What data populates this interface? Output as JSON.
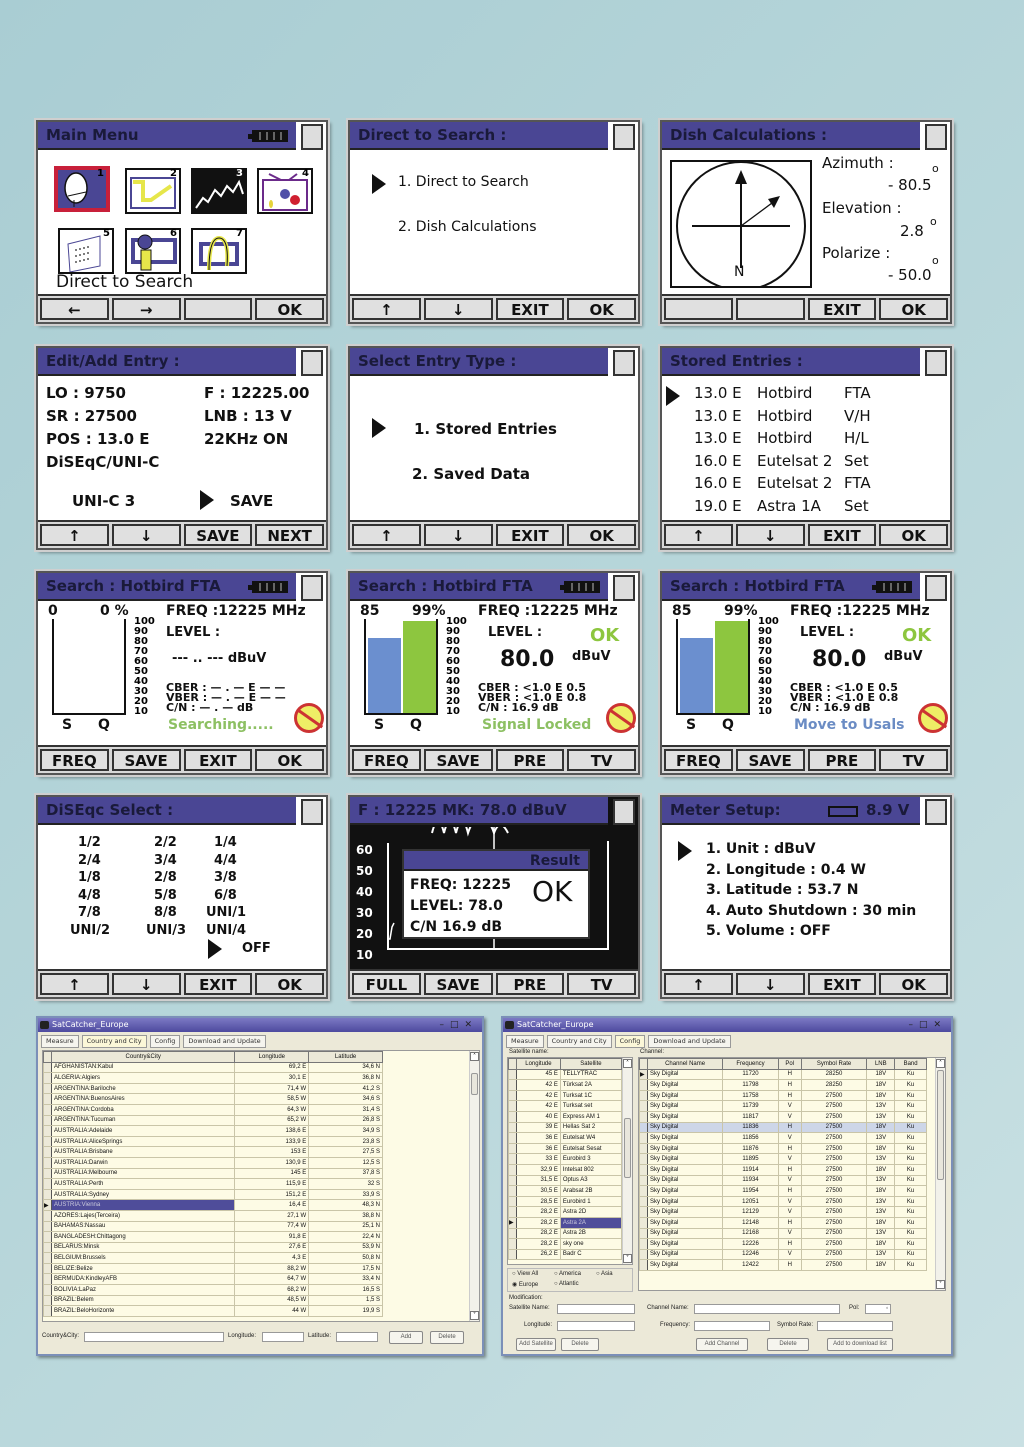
{
  "main_menu": {
    "title": "Main Menu",
    "items": [
      {
        "num": "1",
        "icon": "satellite-dish-icon"
      },
      {
        "num": "2",
        "icon": "checkmark-screen-icon"
      },
      {
        "num": "3",
        "icon": "spectrum-icon"
      },
      {
        "num": "4",
        "icon": "tv-icon"
      },
      {
        "num": "5",
        "icon": "document-icon"
      },
      {
        "num": "6",
        "icon": "magnifier-icon"
      },
      {
        "num": "7",
        "icon": "motor-icon"
      }
    ],
    "selected_label": "Direct to Search",
    "buttons": [
      "←",
      "→",
      "",
      "OK"
    ]
  },
  "direct_search": {
    "title": "Direct to Search :",
    "items": [
      "1. Direct to Search",
      "2. Dish Calculations"
    ],
    "buttons": [
      "↑",
      "↓",
      "EXIT",
      "OK"
    ]
  },
  "dish_calc": {
    "title": "Dish Calculations :",
    "compass_label": "N",
    "azimuth_label": "Azimuth :",
    "azimuth_value": "- 80.5",
    "elevation_label": "Elevation :",
    "elevation_value": "2.8",
    "polarize_label": "Polarize :",
    "polarize_value": "- 50.0",
    "degree": "o",
    "buttons": [
      "",
      "",
      "EXIT",
      "OK"
    ]
  },
  "edit_entry": {
    "title": "Edit/Add Entry :",
    "lo": "LO : 9750",
    "f": "F : 12225.00",
    "sr": "SR : 27500",
    "lnb": "LNB : 13 V",
    "pos": "POS : 13.0 E",
    "khz": "22KHz  ON",
    "diseqc": "DiSEqC/UNI-C",
    "unic": "UNI-C 3",
    "save": "SAVE",
    "buttons": [
      "↑",
      "↓",
      "SAVE",
      "NEXT"
    ]
  },
  "entry_type": {
    "title": "Select Entry Type :",
    "items": [
      "1. Stored Entries",
      "2.  Saved Data"
    ],
    "buttons": [
      "↑",
      "↓",
      "EXIT",
      "OK"
    ]
  },
  "stored_entries": {
    "title": "Stored Entries :",
    "rows": [
      {
        "pos": "13.0 E",
        "sat": "Hotbird",
        "type": "FTA"
      },
      {
        "pos": "13.0 E",
        "sat": "Hotbird",
        "type": "V/H"
      },
      {
        "pos": "13.0 E",
        "sat": "Hotbird",
        "type": "H/L"
      },
      {
        "pos": "16.0 E",
        "sat": "Eutelsat 2",
        "type": "Set"
      },
      {
        "pos": "16.0 E",
        "sat": "Eutelsat 2",
        "type": "FTA"
      },
      {
        "pos": "19.0 E",
        "sat": "Astra 1A",
        "type": "Set"
      }
    ],
    "buttons": [
      "↑",
      "↓",
      "EXIT",
      "OK"
    ]
  },
  "search_panels": [
    {
      "title": "Search : Hotbird FTA",
      "s_val": "0",
      "q_val": "0 %",
      "s_pct": 0,
      "q_pct": 0,
      "freq": "FREQ :12225 MHz",
      "level_label": "LEVEL :",
      "level": "--- .. --- dBuV",
      "unit": "",
      "ok": "",
      "cber": "CBER : — . — E — —",
      "vber": "VBER : — . — E — —",
      "cn": "C/N   : — . —  dB",
      "status": "Searching.....",
      "status_color": "#8dc063",
      "buttons": [
        "FREQ",
        "SAVE",
        "EXIT",
        "OK"
      ]
    },
    {
      "title": "Search : Hotbird FTA",
      "s_val": "85",
      "q_val": "99%",
      "s_pct": 85,
      "q_pct": 99,
      "freq": "FREQ :12225 MHz",
      "level_label": "LEVEL :",
      "level": "80.0",
      "unit": "dBuV",
      "ok": "OK",
      "cber": "CBER : <1.0 E 0.5",
      "vber": "VBER : <1.0 E 0.8",
      "cn": "C/N   : 16.9  dB",
      "status": "Signal Locked",
      "status_color": "#8dc063",
      "buttons": [
        "FREQ",
        "SAVE",
        "PRE",
        "TV"
      ]
    },
    {
      "title": "Search : Hotbird FTA",
      "s_val": "85",
      "q_val": "99%",
      "s_pct": 85,
      "q_pct": 99,
      "freq": "FREQ :12225 MHz",
      "level_label": "LEVEL :",
      "level": "80.0",
      "unit": "dBuV",
      "ok": "OK",
      "cber": "CBER : <1.0 E 0.5",
      "vber": "VBER : <1.0 E 0.8",
      "cn": "C/N   : 16.9  dB",
      "status": "Move to Usals",
      "status_color": "#6b8cc4",
      "buttons": [
        "FREQ",
        "SAVE",
        "PRE",
        "TV"
      ]
    }
  ],
  "search_scale": [
    "100",
    "90",
    "80",
    "70",
    "60",
    "50",
    "40",
    "30",
    "20",
    "10"
  ],
  "search_axis": {
    "s": "S",
    "q": "Q"
  },
  "diseqc": {
    "title": "DiSEqc Select :",
    "cols": [
      [
        "1/2",
        "2/4",
        "1/8",
        "4/8",
        "7/8",
        "UNI/2"
      ],
      [
        "2/2",
        "3/4",
        "2/8",
        "5/8",
        "8/8",
        "UNI/3"
      ],
      [
        "1/4",
        "4/4",
        "3/8",
        "6/8",
        "UNI/1",
        "UNI/4"
      ]
    ],
    "selected": "OFF",
    "buttons": [
      "↑",
      "↓",
      "EXIT",
      "OK"
    ]
  },
  "spectrum": {
    "title": "F : 12225  MK:  78.0 dBuV",
    "yticks": [
      "60",
      "50",
      "40",
      "30",
      "20",
      "10"
    ],
    "result_title": "Result",
    "freq": "FREQ: 12225",
    "level": "LEVEL: 78.0",
    "cn": "C/N  16.9 dB",
    "ok": "OK",
    "buttons": [
      "FULL",
      "SAVE",
      "PRE",
      "TV"
    ]
  },
  "meter_setup": {
    "title": "Meter Setup:",
    "voltage": "8.9 V",
    "items": [
      "1. Unit : dBuV",
      "2. Longitude : 0.4 W",
      "3. Latitude :  53.7 N",
      "4. Auto Shutdown : 30 min",
      "5. Volume : OFF"
    ],
    "buttons": [
      "↑",
      "↓",
      "EXIT",
      "OK"
    ]
  },
  "win1": {
    "title": "SatCatcher_Europe",
    "tabs": [
      "Measure",
      "Country and City",
      "Config",
      "Download and Update"
    ],
    "active_tab": 1,
    "columns": [
      "Country&City",
      "Longitude",
      "Latitude"
    ],
    "rows": [
      [
        "AFGHANISTAN:Kabul",
        "69,2 E",
        "34,6 N"
      ],
      [
        "ALGERIA:Algiers",
        "30,1 E",
        "36,8 N"
      ],
      [
        "ARGENTINA:Bariloche",
        "71,4 W",
        "41,2 S"
      ],
      [
        "ARGENTINA:BuenosAires",
        "58,5 W",
        "34,6 S"
      ],
      [
        "ARGENTINA:Cordoba",
        "64,3 W",
        "31,4 S"
      ],
      [
        "ARGENTINA:Tucuman",
        "65,2 W",
        "26,8 S"
      ],
      [
        "AUSTRALIA:Adelaide",
        "138,6 E",
        "34,9 S"
      ],
      [
        "AUSTRALIA:AliceSprings",
        "133,9 E",
        "23,8 S"
      ],
      [
        "AUSTRALIA:Brisbane",
        "153 E",
        "27,5 S"
      ],
      [
        "AUSTRALIA:Darwin",
        "130,9 E",
        "12,5 S"
      ],
      [
        "AUSTRALIA:Melbourne",
        "145 E",
        "37,8 S"
      ],
      [
        "AUSTRALIA:Perth",
        "115,9 E",
        "32 S"
      ],
      [
        "AUSTRALIA:Sydney",
        "151,2 E",
        "33,9 S"
      ],
      [
        "AUSTRIA:Vienna",
        "16,4 E",
        "48,3 N"
      ],
      [
        "AZORES:Lajes(Terceira)",
        "27,1 W",
        "38,8 N"
      ],
      [
        "BAHAMAS:Nassau",
        "77,4 W",
        "25,1 N"
      ],
      [
        "BANGLADESH:Chittagong",
        "91,8 E",
        "22,4 N"
      ],
      [
        "BELARUS:Minsk",
        "27,6 E",
        "53,9 N"
      ],
      [
        "BELGIUM:Brussels",
        "4,3 E",
        "50,8 N"
      ],
      [
        "BELIZE:Belize",
        "88,2 W",
        "17,5 N"
      ],
      [
        "BERMUDA:KindleyAFB",
        "64,7 W",
        "33,4 N"
      ],
      [
        "BOLIVIA:LaPaz",
        "68,2 W",
        "16,5 S"
      ],
      [
        "BRAZIL:Belem",
        "48,5 W",
        "1,5 S"
      ],
      [
        "BRAZIL:BeloHorizonte",
        "44 W",
        "19,9 S"
      ]
    ],
    "selected_row": 13,
    "form": {
      "city_label": "Country&City:",
      "lon_label": "Longitude:",
      "lat_label": "Latitude:",
      "add": "Add",
      "delete": "Delete"
    }
  },
  "win2": {
    "title": "SatCatcher_Europe",
    "tabs": [
      "Measure",
      "Country and City",
      "Config",
      "Download and Update"
    ],
    "active_tab": 2,
    "sat_label": "Satellite name:",
    "sat_columns": [
      "Longitude",
      "Satellite"
    ],
    "sat_rows": [
      [
        "45 E",
        "TELLYTRAC"
      ],
      [
        "42 E",
        "Türksat 2A"
      ],
      [
        "42 E",
        "Turksat 1C"
      ],
      [
        "42 E",
        "Turksat set"
      ],
      [
        "40 E",
        "Express AM 1"
      ],
      [
        "39 E",
        "Hellas Sat 2"
      ],
      [
        "36 E",
        "Eutelsat W4"
      ],
      [
        "36 E",
        "Eutelsat Sesat"
      ],
      [
        "33 E",
        "Eurobird 3"
      ],
      [
        "32,9 E",
        "Intelsat 802"
      ],
      [
        "31,5 E",
        "Optus A3"
      ],
      [
        "30,5 E",
        "Arabsat 2B"
      ],
      [
        "28,5 E",
        "Eurobird 1"
      ],
      [
        "28,2 E",
        "Astra 2D"
      ],
      [
        "28,2 E",
        "Astra 2A"
      ],
      [
        "28,2 E",
        "Astra 2B"
      ],
      [
        "28,2 E",
        "sky one"
      ],
      [
        "26,2 E",
        "Badr C"
      ]
    ],
    "sat_selected": 14,
    "regions": [
      {
        "label": "View All",
        "checked": false
      },
      {
        "label": "America",
        "checked": false
      },
      {
        "label": "Asia",
        "checked": false
      },
      {
        "label": "Europe",
        "checked": true
      },
      {
        "label": "Atlantic",
        "checked": false
      }
    ],
    "ch_label": "Channel:",
    "ch_columns": [
      "Channel Name",
      "Frequency",
      "Pol",
      "Symbol Rate",
      "LNB",
      "Band"
    ],
    "ch_rows": [
      [
        "Sky Digital",
        "11720",
        "H",
        "28250",
        "18V",
        "Ku"
      ],
      [
        "Sky Digital",
        "11798",
        "H",
        "28250",
        "18V",
        "Ku"
      ],
      [
        "Sky Digital",
        "11758",
        "H",
        "27500",
        "18V",
        "Ku"
      ],
      [
        "Sky Digital",
        "11739",
        "V",
        "27500",
        "13V",
        "Ku"
      ],
      [
        "Sky Digital",
        "11817",
        "V",
        "27500",
        "13V",
        "Ku"
      ],
      [
        "Sky Digital",
        "11836",
        "H",
        "27500",
        "18V",
        "Ku"
      ],
      [
        "Sky Digital",
        "11856",
        "V",
        "27500",
        "13V",
        "Ku"
      ],
      [
        "Sky Digital",
        "11876",
        "H",
        "27500",
        "18V",
        "Ku"
      ],
      [
        "Sky Digital",
        "11895",
        "V",
        "27500",
        "13V",
        "Ku"
      ],
      [
        "Sky Digital",
        "11914",
        "H",
        "27500",
        "18V",
        "Ku"
      ],
      [
        "Sky Digital",
        "11934",
        "V",
        "27500",
        "13V",
        "Ku"
      ],
      [
        "Sky Digital",
        "11954",
        "H",
        "27500",
        "18V",
        "Ku"
      ],
      [
        "Sky Digital",
        "12051",
        "V",
        "27500",
        "13V",
        "Ku"
      ],
      [
        "Sky Digital",
        "12129",
        "V",
        "27500",
        "13V",
        "Ku"
      ],
      [
        "Sky Digital",
        "12148",
        "H",
        "27500",
        "18V",
        "Ku"
      ],
      [
        "Sky Digital",
        "12168",
        "V",
        "27500",
        "13V",
        "Ku"
      ],
      [
        "Sky Digital",
        "12226",
        "H",
        "27500",
        "18V",
        "Ku"
      ],
      [
        "Sky Digital",
        "12246",
        "V",
        "27500",
        "13V",
        "Ku"
      ],
      [
        "Sky Digital",
        "12422",
        "H",
        "27500",
        "18V",
        "Ku"
      ]
    ],
    "ch_highlight": 5,
    "form": {
      "modification": "Modification:",
      "sat_name": "Satellite  Name:",
      "longitude": "Longitude:",
      "add_sat": "Add Satellite",
      "delete": "Delete",
      "ch_name": "Channel Name:",
      "frequency": "Frequency:",
      "symbol_rate": "Symbol Rate:",
      "pol": "Pol:",
      "add_ch": "Add Channel",
      "delete2": "Delete",
      "add_dl": "Add to download list"
    }
  }
}
